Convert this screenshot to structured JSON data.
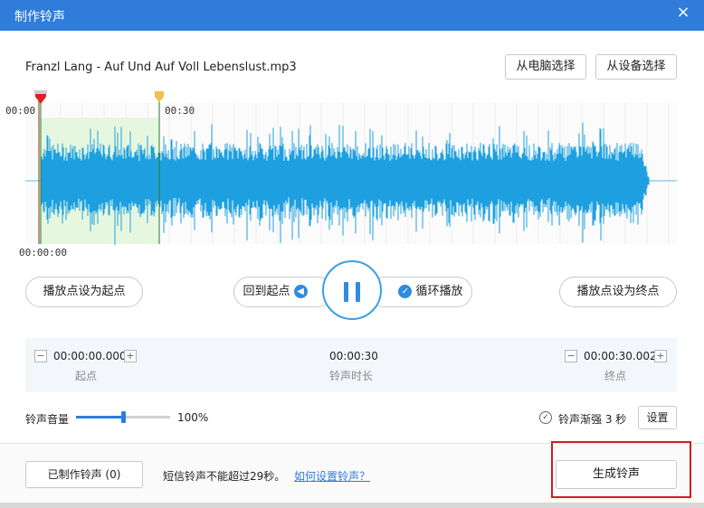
{
  "window": {
    "title": "制作铃声",
    "close_glyph": "×"
  },
  "file": {
    "name": "Franzl Lang - Auf Und Auf Voll Lebenslust.mp3",
    "from_pc_label": "从电脑选择",
    "from_device_label": "从设备选择"
  },
  "waveform": {
    "tick_start": "00:00",
    "tick_30": "00:30",
    "playhead_time": "00:00:00",
    "color": "#1ea0e0",
    "selection_color": "#e6f7e0",
    "start_marker_color": "#e02020",
    "end_marker_color": "#f0c050"
  },
  "controls": {
    "set_start_label": "播放点设为起点",
    "back_to_start_label": "回到起点",
    "loop_label": "循环播放",
    "set_end_label": "播放点设为终点",
    "play_state": "pause-icon"
  },
  "range": {
    "start_value": "00:00:00.000",
    "start_label": "起点",
    "duration_value": "00:00:30",
    "duration_label": "铃声时长",
    "end_value": "00:00:30.002",
    "end_label": "终点",
    "minus": "−",
    "plus": "+"
  },
  "volume": {
    "label": "铃声音量",
    "value": 1.0,
    "display": "100%"
  },
  "fade": {
    "checked": true,
    "label": "铃声渐强 3 秒",
    "settings_label": "设置"
  },
  "footer": {
    "made_label": "已制作铃声 (0)",
    "note": "短信铃声不能超过29秒。",
    "help_link": "如何设置铃声？",
    "generate_label": "生成铃声"
  },
  "colors": {
    "titlebar": "#2f7cdb",
    "accent": "#2f8be0",
    "highlight": "#d21e1e"
  }
}
